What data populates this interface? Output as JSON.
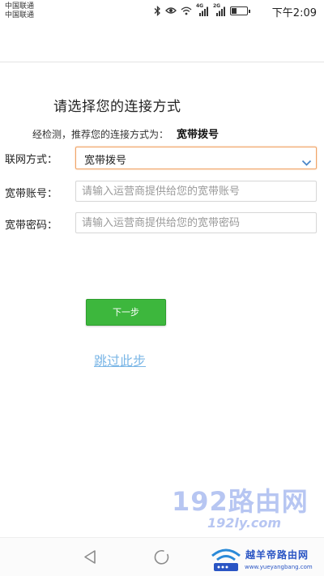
{
  "status_bar": {
    "carrier_1": "中国联通",
    "carrier_2": "中国联通",
    "network_1": "4G",
    "network_2": "2G",
    "time": "下午2:09"
  },
  "page": {
    "title": "请选择您的连接方式",
    "recommend_prefix": "经检测，推荐您的连接方式为：",
    "recommend_value": "宽带拨号"
  },
  "form": {
    "connection_type": {
      "label": "联网方式：",
      "value": "宽带拨号"
    },
    "account": {
      "label": "宽带账号：",
      "placeholder": "请输入运营商提供给您的宽带账号",
      "value": ""
    },
    "password": {
      "label": "宽带密码：",
      "placeholder": "请输入运营商提供给您的宽带密码",
      "value": ""
    }
  },
  "actions": {
    "next_label": "下一步",
    "skip_label": "跳过此步"
  },
  "watermark": {
    "text": "192路由网",
    "subtext": "192ly.com"
  },
  "site_logo": {
    "name": "越羊帝路由网",
    "url": "www.yueyangbang.com"
  },
  "colors": {
    "primary_button": "#3db73d",
    "focus_border": "#f0a365",
    "link": "#7ab6e6",
    "watermark": "#b7c6f2"
  },
  "icons": [
    "bluetooth-icon",
    "eye-icon",
    "wifi-icon",
    "signal-icon",
    "battery-icon",
    "chevron-down-icon",
    "back-icon",
    "home-icon",
    "router-logo-icon"
  ]
}
